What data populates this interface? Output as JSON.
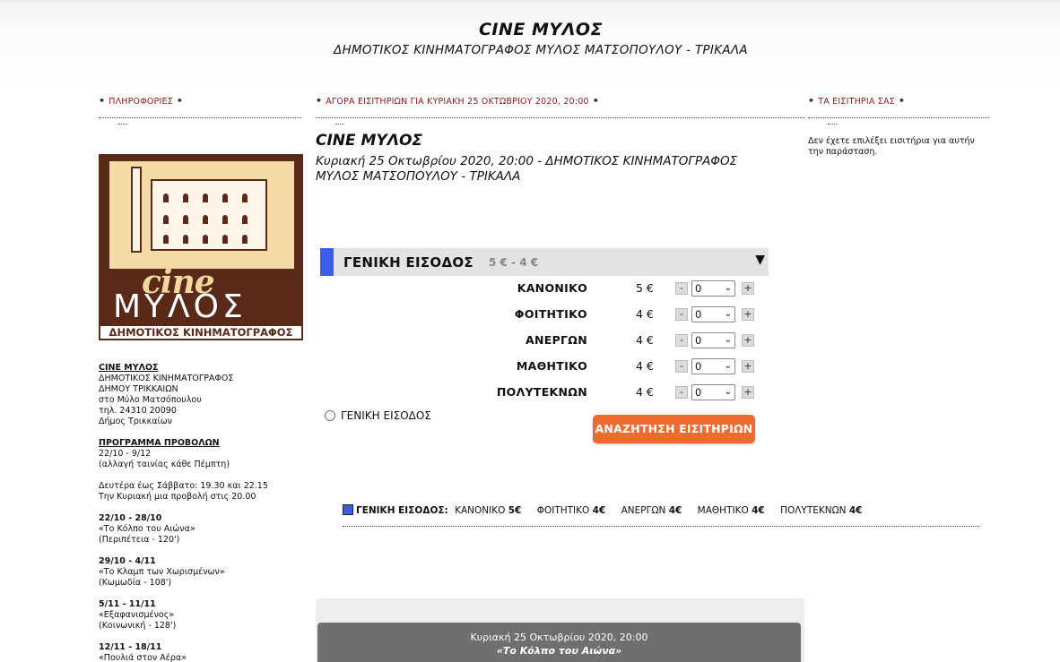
{
  "header": {
    "title": "CINE ΜΥΛΟΣ",
    "subtitle": "ΔΗΜΟΤΙΚΟΣ ΚΙΝΗΜΑΤΟΓΡΑΦΟΣ ΜΥΛΟΣ ΜΑΤΣΟΠΟΥΛΟΥ - ΤΡΙΚΑΛΑ"
  },
  "sections": {
    "info": "ΠΛΗΡΟΦΟΡΙΕΣ",
    "purchase": "ΑΓΟΡΑ ΕΙΣΙΤΗΡΙΩΝ ΓΙΑ ΚΥΡΙΑΚΗ 25 ΟΚΤΩΒΡΙΟΥ 2020, 20:00",
    "tickets": "ΤΑ ΕΙΣΙΤΗΡΙΑ ΣΑΣ"
  },
  "logo": {
    "cine": "cine",
    "mylos": "ΜΥΛΟΣ",
    "band": "ΔΗΜΟΤΙΚΟΣ ΚΙΝΗΜΑΤΟΓΡΑΦΟΣ"
  },
  "info": {
    "venue_name": "CINE ΜΥΛΟΣ",
    "venue_lines": [
      "ΔΗΜΟΤΙΚΟΣ ΚΙΝΗΜΑΤΟΓΡΑΦΟΣ",
      "ΔΗΜΟΥ ΤΡΙΚΚΑΙΩΝ",
      "στο Μύλο Ματσόπουλου",
      "τηλ. 24310 20090",
      "Δήμος Τρικκαίων"
    ],
    "program_heading": "ΠΡΟΓΡΑΜΜΑ ΠΡΟΒΟΛΩΝ",
    "program_lines": [
      "22/10 - 9/12",
      "(αλλαγή ταινίας κάθε Πέμπτη)"
    ],
    "schedule_lines": [
      "Δευτέρα έως Σάββατο: 19.30 και 22.15",
      "Την Κυριακή μια προβολή στις 20.00"
    ],
    "weeks": [
      {
        "dates": "22/10 - 28/10",
        "movie": "«Το Κόλπο του Αιώνα»",
        "genre": "(Περιπέτεια - 120')"
      },
      {
        "dates": "29/10 - 4/11",
        "movie": "«Το Κλαμπ των Χωρισμένων»",
        "genre": "(Κωμωδία - 108')"
      },
      {
        "dates": "5/11 - 11/11",
        "movie": "«Εξαφανισμένος»",
        "genre": "(Κοινωνική - 128')"
      },
      {
        "dates": "12/11 - 18/11",
        "movie": "«Πουλιά στον Αέρα»",
        "genre": ""
      }
    ]
  },
  "event": {
    "title": "CINE ΜΥΛΟΣ",
    "description": "Κυριακή 25 Οκτωβρίου 2020, 20:00 - ΔΗΜΟΤΙΚΟΣ ΚΙΝΗΜΑΤΟΓΡΑΦΟΣ ΜΥΛΟΣ ΜΑΤΣΟΠΟΥΛΟΥ - ΤΡΙΚΑΛΑ"
  },
  "zone": {
    "name": "ΓΕΝΙΚΗ ΕΙΣΟΔΟΣ",
    "range": "5 € - 4 €",
    "arrow": "▼",
    "color": "#3b5ee8"
  },
  "prices": [
    {
      "label": "ΚΑΝΟΝΙΚΟ",
      "amount": "5 €",
      "qty": "0"
    },
    {
      "label": "ΦΟΙΤΗΤΙΚΟ",
      "amount": "4 €",
      "qty": "0"
    },
    {
      "label": "ΑΝΕΡΓΩΝ",
      "amount": "4 €",
      "qty": "0"
    },
    {
      "label": "ΜΑΘΗΤΙΚΟ",
      "amount": "4 €",
      "qty": "0"
    },
    {
      "label": "ΠΟΛΥΤΕΚΝΩΝ",
      "amount": "4 €",
      "qty": "0"
    }
  ],
  "stepper": {
    "minus": "-",
    "plus": "+"
  },
  "radio_label": "ΓΕΝΙΚΗ ΕΙΣΟΔΟΣ",
  "search_button": "ΑΝΑΖΗΤΗΣΗ ΕΙΣΙΤΗΡΙΩΝ",
  "legend": {
    "zone": "ΓΕΝΙΚΗ ΕΙΣΟΔΟΣ:",
    "items": [
      {
        "label": "ΚΑΝΟΝΙΚΟ",
        "price": "5€"
      },
      {
        "label": "ΦΟΙΤΗΤΙΚΟ",
        "price": "4€"
      },
      {
        "label": "ΑΝΕΡΓΩΝ",
        "price": "4€"
      },
      {
        "label": "ΜΑΘΗΤΙΚΟ",
        "price": "4€"
      },
      {
        "label": "ΠΟΛΥΤΕΚΝΩΝ",
        "price": "4€"
      }
    ]
  },
  "show": {
    "datetime": "Κυριακή 25 Οκτωβρίου 2020, 20:00",
    "movie": "«Το Κόλπο του Αιώνα»"
  },
  "right_note": "Δεν έχετε επιλέξει εισιτήρια για αυτήν την παράσταση."
}
